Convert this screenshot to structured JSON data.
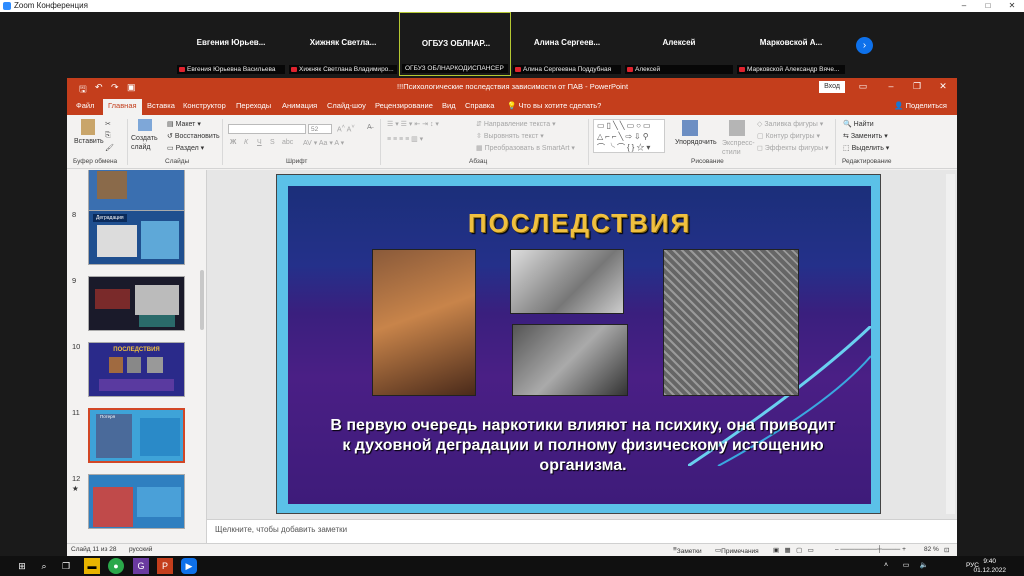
{
  "zoom": {
    "window_title": "Zoom Конференция",
    "minimize": "–",
    "maximize": "□",
    "close": "✕",
    "next_arrow": "›",
    "participants": [
      {
        "name": "Евгения  Юрьев...",
        "caption": "Евгения Юрьевна Васильева",
        "muted": true
      },
      {
        "name": "Хижняк  Светла...",
        "caption": "Хижняк Светлана Владимиро...",
        "muted": true
      },
      {
        "name": "ОГБУЗ  ОБЛНАР...",
        "caption": "ОГБУЗ ОБЛНАРКОДИСПАНСЕР",
        "muted": false,
        "active": true
      },
      {
        "name": "Алина  Сергеев...",
        "caption": "Алина Сергеевна Поддубная",
        "muted": true
      },
      {
        "name": "Алексей",
        "caption": "Алексей",
        "muted": true
      },
      {
        "name": "Марковской  А...",
        "caption": "Марковской Александр Вяче...",
        "muted": true
      }
    ]
  },
  "powerpoint": {
    "title": "!!!Психологические последствия зависимости от ПАВ  -  PowerPoint",
    "login": "Вход",
    "share": "Поделиться",
    "tabs": [
      "Файл",
      "Главная",
      "Вставка",
      "Конструктор",
      "Переходы",
      "Анимация",
      "Слайд-шоу",
      "Рецензирование",
      "Вид",
      "Справка",
      "Что вы хотите сделать?"
    ],
    "ribbon": {
      "paste": "Вставить",
      "create_slide": "Создать слайд",
      "layout": "Макет",
      "reset": "Восстановить",
      "section": "Раздел",
      "font_size": "52",
      "bold": "Ж",
      "italic": "К",
      "underline": "Ч",
      "strike": "S",
      "abc": "abc",
      "text_direction": "Направление текста",
      "align_text": "Выровнять текст",
      "smartart": "Преобразовать в SmartArt",
      "arrange": "Упорядочить",
      "express_styles": "Экспресс-стили",
      "shape_fill": "Заливка фигуры",
      "shape_outline": "Контур фигуры",
      "shape_effects": "Эффекты фигуры",
      "find": "Найти",
      "replace": "Заменить",
      "select": "Выделить",
      "groups": [
        "Буфер обмена",
        "Слайды",
        "Шрифт",
        "Абзац",
        "Рисование",
        "Редактирование"
      ]
    },
    "thumbnails": [
      {
        "num": "",
        "bg": "#3a6fb0"
      },
      {
        "num": "8",
        "title": "Деградация",
        "bg": "#1f4f8f"
      },
      {
        "num": "9",
        "title": "",
        "bg": "#1a1a2a"
      },
      {
        "num": "10",
        "title": "ПОСЛЕДСТВИЯ",
        "bg": "#2a2a8a"
      },
      {
        "num": "11",
        "title": "Потеря",
        "bg": "#3ea3d8",
        "selected": true
      },
      {
        "num": "12",
        "star": "★",
        "title": "",
        "bg": "#2f7fc0"
      }
    ],
    "slide": {
      "title": "ПОСЛЕДСТВИЯ",
      "body": "В первую очередь наркотики влияют на психику, она приводит к духовной деградации и полному физическому истощению организма."
    },
    "notes_placeholder": "Щелкните, чтобы добавить заметки",
    "status": {
      "slide_counter": "Слайд 11 из 28",
      "language": "русский",
      "notes": "Заметки",
      "comments": "Примечания",
      "zoom": "82 %"
    }
  },
  "taskbar": {
    "time": "9:40",
    "date": "01.12.2022",
    "lang": "РУС"
  }
}
